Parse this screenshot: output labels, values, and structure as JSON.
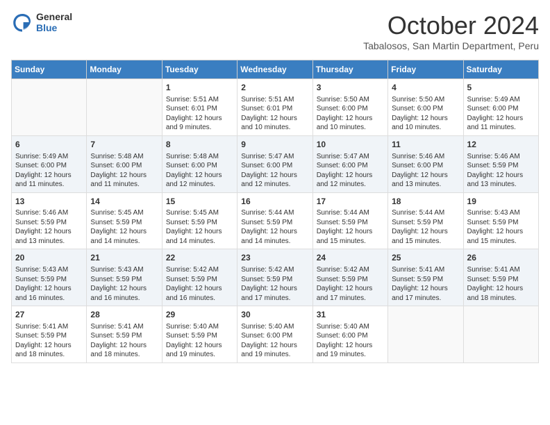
{
  "header": {
    "logo": {
      "general": "General",
      "blue": "Blue"
    },
    "month": "October 2024",
    "subtitle": "Tabalosos, San Martin Department, Peru"
  },
  "weekdays": [
    "Sunday",
    "Monday",
    "Tuesday",
    "Wednesday",
    "Thursday",
    "Friday",
    "Saturday"
  ],
  "weeks": [
    [
      {
        "day": "",
        "info": ""
      },
      {
        "day": "",
        "info": ""
      },
      {
        "day": "1",
        "info": "Sunrise: 5:51 AM\nSunset: 6:01 PM\nDaylight: 12 hours and 9 minutes."
      },
      {
        "day": "2",
        "info": "Sunrise: 5:51 AM\nSunset: 6:01 PM\nDaylight: 12 hours and 10 minutes."
      },
      {
        "day": "3",
        "info": "Sunrise: 5:50 AM\nSunset: 6:00 PM\nDaylight: 12 hours and 10 minutes."
      },
      {
        "day": "4",
        "info": "Sunrise: 5:50 AM\nSunset: 6:00 PM\nDaylight: 12 hours and 10 minutes."
      },
      {
        "day": "5",
        "info": "Sunrise: 5:49 AM\nSunset: 6:00 PM\nDaylight: 12 hours and 11 minutes."
      }
    ],
    [
      {
        "day": "6",
        "info": "Sunrise: 5:49 AM\nSunset: 6:00 PM\nDaylight: 12 hours and 11 minutes."
      },
      {
        "day": "7",
        "info": "Sunrise: 5:48 AM\nSunset: 6:00 PM\nDaylight: 12 hours and 11 minutes."
      },
      {
        "day": "8",
        "info": "Sunrise: 5:48 AM\nSunset: 6:00 PM\nDaylight: 12 hours and 12 minutes."
      },
      {
        "day": "9",
        "info": "Sunrise: 5:47 AM\nSunset: 6:00 PM\nDaylight: 12 hours and 12 minutes."
      },
      {
        "day": "10",
        "info": "Sunrise: 5:47 AM\nSunset: 6:00 PM\nDaylight: 12 hours and 12 minutes."
      },
      {
        "day": "11",
        "info": "Sunrise: 5:46 AM\nSunset: 6:00 PM\nDaylight: 12 hours and 13 minutes."
      },
      {
        "day": "12",
        "info": "Sunrise: 5:46 AM\nSunset: 5:59 PM\nDaylight: 12 hours and 13 minutes."
      }
    ],
    [
      {
        "day": "13",
        "info": "Sunrise: 5:46 AM\nSunset: 5:59 PM\nDaylight: 12 hours and 13 minutes."
      },
      {
        "day": "14",
        "info": "Sunrise: 5:45 AM\nSunset: 5:59 PM\nDaylight: 12 hours and 14 minutes."
      },
      {
        "day": "15",
        "info": "Sunrise: 5:45 AM\nSunset: 5:59 PM\nDaylight: 12 hours and 14 minutes."
      },
      {
        "day": "16",
        "info": "Sunrise: 5:44 AM\nSunset: 5:59 PM\nDaylight: 12 hours and 14 minutes."
      },
      {
        "day": "17",
        "info": "Sunrise: 5:44 AM\nSunset: 5:59 PM\nDaylight: 12 hours and 15 minutes."
      },
      {
        "day": "18",
        "info": "Sunrise: 5:44 AM\nSunset: 5:59 PM\nDaylight: 12 hours and 15 minutes."
      },
      {
        "day": "19",
        "info": "Sunrise: 5:43 AM\nSunset: 5:59 PM\nDaylight: 12 hours and 15 minutes."
      }
    ],
    [
      {
        "day": "20",
        "info": "Sunrise: 5:43 AM\nSunset: 5:59 PM\nDaylight: 12 hours and 16 minutes."
      },
      {
        "day": "21",
        "info": "Sunrise: 5:43 AM\nSunset: 5:59 PM\nDaylight: 12 hours and 16 minutes."
      },
      {
        "day": "22",
        "info": "Sunrise: 5:42 AM\nSunset: 5:59 PM\nDaylight: 12 hours and 16 minutes."
      },
      {
        "day": "23",
        "info": "Sunrise: 5:42 AM\nSunset: 5:59 PM\nDaylight: 12 hours and 17 minutes."
      },
      {
        "day": "24",
        "info": "Sunrise: 5:42 AM\nSunset: 5:59 PM\nDaylight: 12 hours and 17 minutes."
      },
      {
        "day": "25",
        "info": "Sunrise: 5:41 AM\nSunset: 5:59 PM\nDaylight: 12 hours and 17 minutes."
      },
      {
        "day": "26",
        "info": "Sunrise: 5:41 AM\nSunset: 5:59 PM\nDaylight: 12 hours and 18 minutes."
      }
    ],
    [
      {
        "day": "27",
        "info": "Sunrise: 5:41 AM\nSunset: 5:59 PM\nDaylight: 12 hours and 18 minutes."
      },
      {
        "day": "28",
        "info": "Sunrise: 5:41 AM\nSunset: 5:59 PM\nDaylight: 12 hours and 18 minutes."
      },
      {
        "day": "29",
        "info": "Sunrise: 5:40 AM\nSunset: 5:59 PM\nDaylight: 12 hours and 19 minutes."
      },
      {
        "day": "30",
        "info": "Sunrise: 5:40 AM\nSunset: 6:00 PM\nDaylight: 12 hours and 19 minutes."
      },
      {
        "day": "31",
        "info": "Sunrise: 5:40 AM\nSunset: 6:00 PM\nDaylight: 12 hours and 19 minutes."
      },
      {
        "day": "",
        "info": ""
      },
      {
        "day": "",
        "info": ""
      }
    ]
  ]
}
